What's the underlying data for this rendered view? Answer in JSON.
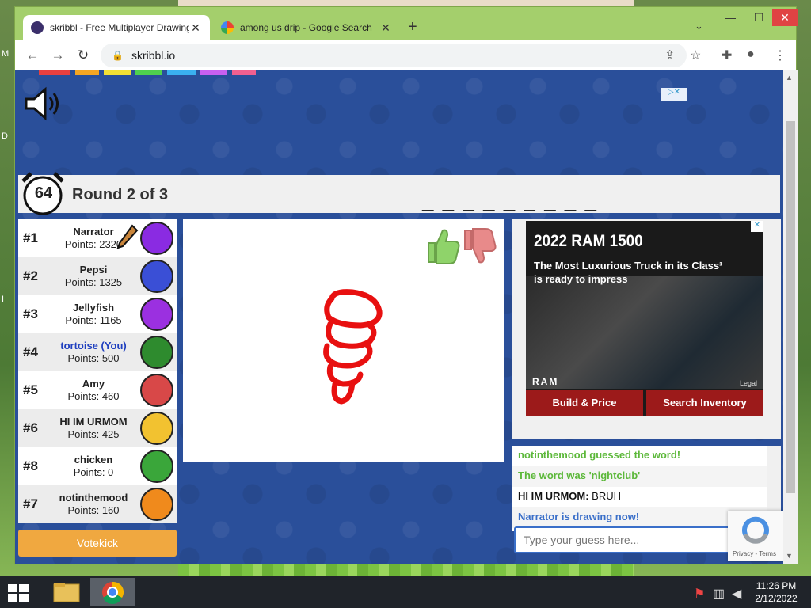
{
  "desktop": {
    "edge_letters": [
      "M",
      "D",
      "I"
    ]
  },
  "browser": {
    "tabs": [
      {
        "title": "skribbl - Free Multiplayer Drawing",
        "active": true
      },
      {
        "title": "among us drip - Google Search",
        "active": false
      }
    ],
    "url": "skribbl.io"
  },
  "game": {
    "timer": "64",
    "round": "Round 2 of 3",
    "word_hint": "_ _ _ _ _ _ _ _ _",
    "ad_choices": "▷✕",
    "players": [
      {
        "rank": "#1",
        "name": "Narrator",
        "points": "Points: 2320",
        "you": false,
        "avatar_color": "#8a2be2",
        "drawing": true
      },
      {
        "rank": "#2",
        "name": "Pepsi",
        "points": "Points: 1325",
        "you": false,
        "avatar_color": "#3a4fd6",
        "drawing": false
      },
      {
        "rank": "#3",
        "name": "Jellyfish",
        "points": "Points: 1165",
        "you": false,
        "avatar_color": "#9b30e0",
        "drawing": false
      },
      {
        "rank": "#4",
        "name": "tortoise (You)",
        "points": "Points: 500",
        "you": true,
        "avatar_color": "#2e8b2e",
        "drawing": false
      },
      {
        "rank": "#5",
        "name": "Amy",
        "points": "Points: 460",
        "you": false,
        "avatar_color": "#d84848",
        "drawing": false
      },
      {
        "rank": "#6",
        "name": "HI IM URMOM",
        "points": "Points: 425",
        "you": false,
        "avatar_color": "#f2c230",
        "drawing": false
      },
      {
        "rank": "#8",
        "name": "chicken",
        "points": "Points: 0",
        "you": false,
        "avatar_color": "#3aa63a",
        "drawing": false
      },
      {
        "rank": "#7",
        "name": "notinthemood",
        "points": "Points: 160",
        "you": false,
        "avatar_color": "#f08a1c",
        "drawing": false
      }
    ],
    "votekick_label": "Votekick",
    "chat": [
      {
        "type": "green",
        "text": "notinthemood guessed the word!"
      },
      {
        "type": "green",
        "text": "The word was 'nightclub'"
      },
      {
        "type": "msg",
        "who": "HI IM URMOM:",
        "text": "BRUH"
      },
      {
        "type": "blue",
        "text": "Narrator is drawing now!"
      }
    ],
    "guess_placeholder": "Type your guess here...",
    "stroke_color": "#e81010"
  },
  "ad": {
    "title": "2022 RAM 1500",
    "subtitle": "The Most Luxurious Truck in its Class¹ is ready to impress",
    "brand": "RAM",
    "legal": "Legal",
    "cta_1": "Build & Price",
    "cta_2": "Search Inventory"
  },
  "recaptcha": {
    "terms": "Privacy - Terms"
  },
  "taskbar": {
    "time": "11:26 PM",
    "date": "2/12/2022"
  }
}
